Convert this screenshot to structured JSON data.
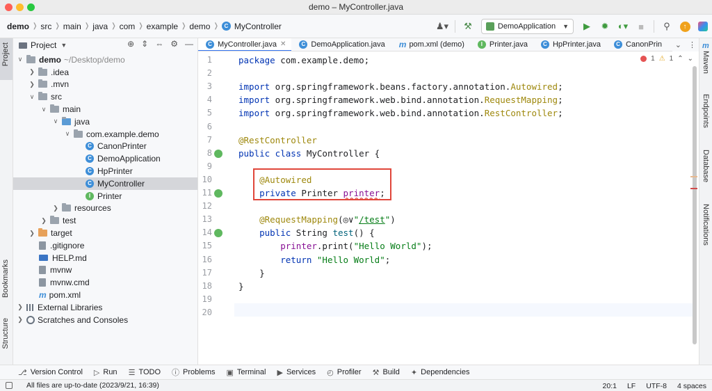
{
  "window": {
    "title": "demo – MyController.java"
  },
  "breadcrumb": [
    "demo",
    "src",
    "main",
    "java",
    "com",
    "example",
    "demo",
    "MyController"
  ],
  "run_config": {
    "label": "DemoApplication"
  },
  "project_panel": {
    "title": "Project"
  },
  "left_stripe": {
    "project": "Project",
    "bookmarks": "Bookmarks",
    "structure": "Structure"
  },
  "right_stripe": {
    "maven": "Maven",
    "endpoints": "Endpoints",
    "database": "Database",
    "notifications": "Notifications"
  },
  "tree": [
    {
      "label": "demo",
      "extra": "~/Desktop/demo",
      "icon": "folder",
      "chev": "v",
      "indent": 0,
      "bold": true
    },
    {
      "label": ".idea",
      "icon": "folder",
      "chev": ">",
      "indent": 1
    },
    {
      "label": ".mvn",
      "icon": "folder",
      "chev": ">",
      "indent": 1
    },
    {
      "label": "src",
      "icon": "folder",
      "chev": "v",
      "indent": 1
    },
    {
      "label": "main",
      "icon": "folder",
      "chev": "v",
      "indent": 2
    },
    {
      "label": "java",
      "icon": "folder-blue",
      "chev": "v",
      "indent": 3
    },
    {
      "label": "com.example.demo",
      "icon": "package",
      "chev": "v",
      "indent": 4
    },
    {
      "label": "CanonPrinter",
      "icon": "class",
      "chev": "",
      "indent": 5
    },
    {
      "label": "DemoApplication",
      "icon": "class",
      "chev": "",
      "indent": 5
    },
    {
      "label": "HpPrinter",
      "icon": "class",
      "chev": "",
      "indent": 5
    },
    {
      "label": "MyController",
      "icon": "class",
      "chev": "",
      "indent": 5,
      "selected": true
    },
    {
      "label": "Printer",
      "icon": "interface",
      "chev": "",
      "indent": 5
    },
    {
      "label": "resources",
      "icon": "folder",
      "chev": ">",
      "indent": 3
    },
    {
      "label": "test",
      "icon": "folder",
      "chev": ">",
      "indent": 2
    },
    {
      "label": "target",
      "icon": "folder-orange",
      "chev": ">",
      "indent": 1
    },
    {
      "label": ".gitignore",
      "icon": "file",
      "chev": "",
      "indent": 1
    },
    {
      "label": "HELP.md",
      "icon": "md",
      "chev": "",
      "indent": 1
    },
    {
      "label": "mvnw",
      "icon": "file",
      "chev": "",
      "indent": 1
    },
    {
      "label": "mvnw.cmd",
      "icon": "file",
      "chev": "",
      "indent": 1
    },
    {
      "label": "pom.xml",
      "icon": "maven",
      "chev": "",
      "indent": 1
    },
    {
      "label": "External Libraries",
      "icon": "libs",
      "chev": ">",
      "indent": 0
    },
    {
      "label": "Scratches and Consoles",
      "icon": "scratch",
      "chev": ">",
      "indent": 0
    }
  ],
  "tabs": [
    {
      "label": "MyController.java",
      "icon": "class",
      "active": true,
      "closable": true
    },
    {
      "label": "DemoApplication.java",
      "icon": "class"
    },
    {
      "label": "pom.xml (demo)",
      "icon": "maven"
    },
    {
      "label": "Printer.java",
      "icon": "interface"
    },
    {
      "label": "HpPrinter.java",
      "icon": "class"
    },
    {
      "label": "CanonPrin",
      "icon": "class"
    }
  ],
  "inspections": {
    "errors": "1",
    "warnings": "1"
  },
  "code_lines": [
    {
      "n": "1",
      "tokens": [
        [
          "kw",
          "package"
        ],
        [
          "",
          " com.example.demo;"
        ]
      ]
    },
    {
      "n": "2",
      "tokens": []
    },
    {
      "n": "3",
      "tokens": [
        [
          "kw",
          "import"
        ],
        [
          "",
          " org.springframework.beans.factory.annotation."
        ],
        [
          "ann",
          "Autowired"
        ],
        [
          "",
          ";"
        ]
      ]
    },
    {
      "n": "4",
      "tokens": [
        [
          "kw",
          "import"
        ],
        [
          "",
          " org.springframework.web.bind.annotation."
        ],
        [
          "ann",
          "RequestMapping"
        ],
        [
          "",
          ";"
        ]
      ]
    },
    {
      "n": "5",
      "tokens": [
        [
          "kw",
          "import"
        ],
        [
          "",
          " org.springframework.web.bind.annotation."
        ],
        [
          "ann",
          "RestController"
        ],
        [
          "",
          ";"
        ]
      ]
    },
    {
      "n": "6",
      "tokens": []
    },
    {
      "n": "7",
      "tokens": [
        [
          "ann",
          "@RestController"
        ]
      ]
    },
    {
      "n": "8",
      "tokens": [
        [
          "kw",
          "public class"
        ],
        [
          "",
          " MyController {"
        ]
      ]
    },
    {
      "n": "9",
      "tokens": []
    },
    {
      "n": "10",
      "tokens": [
        [
          "",
          "    "
        ],
        [
          "ann",
          "@Autowired"
        ]
      ]
    },
    {
      "n": "11",
      "tokens": [
        [
          "",
          "    "
        ],
        [
          "kw",
          "private"
        ],
        [
          "",
          " Printer "
        ],
        [
          "squig",
          "printer"
        ],
        [
          "",
          ";"
        ]
      ]
    },
    {
      "n": "12",
      "tokens": []
    },
    {
      "n": "13",
      "tokens": [
        [
          "",
          "    "
        ],
        [
          "ann",
          "@RequestMapping"
        ],
        [
          "",
          "(◎∨"
        ],
        [
          "str",
          "\""
        ],
        [
          "link",
          "/test"
        ],
        [
          "str",
          "\""
        ],
        [
          "",
          ")"
        ]
      ]
    },
    {
      "n": "14",
      "tokens": [
        [
          "",
          "    "
        ],
        [
          "kw",
          "public"
        ],
        [
          "",
          " String "
        ],
        [
          "fn",
          "test"
        ],
        [
          "",
          "() {"
        ]
      ]
    },
    {
      "n": "15",
      "tokens": [
        [
          "",
          "        "
        ],
        [
          "fld",
          "printer"
        ],
        [
          "",
          ".print("
        ],
        [
          "str",
          "\"Hello World\""
        ],
        [
          "",
          ");"
        ]
      ]
    },
    {
      "n": "16",
      "tokens": [
        [
          "",
          "        "
        ],
        [
          "kw",
          "return"
        ],
        [
          "",
          ""
        ],
        [
          "str",
          " \"Hello World\""
        ],
        [
          "",
          ";"
        ]
      ]
    },
    {
      "n": "17",
      "tokens": [
        [
          "",
          "    }"
        ]
      ]
    },
    {
      "n": "18",
      "tokens": [
        [
          "",
          "}"
        ]
      ]
    },
    {
      "n": "19",
      "tokens": []
    },
    {
      "n": "20",
      "tokens": []
    }
  ],
  "bottom_tools": [
    {
      "label": "Version Control",
      "icon": "branch-icon",
      "glyph": "⎇"
    },
    {
      "label": "Run",
      "icon": "run-icon",
      "glyph": "▷"
    },
    {
      "label": "TODO",
      "icon": "todo-icon",
      "glyph": "☰"
    },
    {
      "label": "Problems",
      "icon": "problems-icon",
      "glyph": "ⓘ"
    },
    {
      "label": "Terminal",
      "icon": "terminal-icon",
      "glyph": "▣"
    },
    {
      "label": "Services",
      "icon": "services-icon",
      "glyph": "▶"
    },
    {
      "label": "Profiler",
      "icon": "profiler-icon",
      "glyph": "◴"
    },
    {
      "label": "Build",
      "icon": "hammer-icon",
      "glyph": "⚒"
    },
    {
      "label": "Dependencies",
      "icon": "dependencies-icon",
      "glyph": "✦"
    }
  ],
  "status": {
    "message": "All files are up-to-date (2023/9/21, 16:39)",
    "position": "20:1",
    "line_sep": "LF",
    "encoding": "UTF-8",
    "indent": "4 spaces"
  }
}
